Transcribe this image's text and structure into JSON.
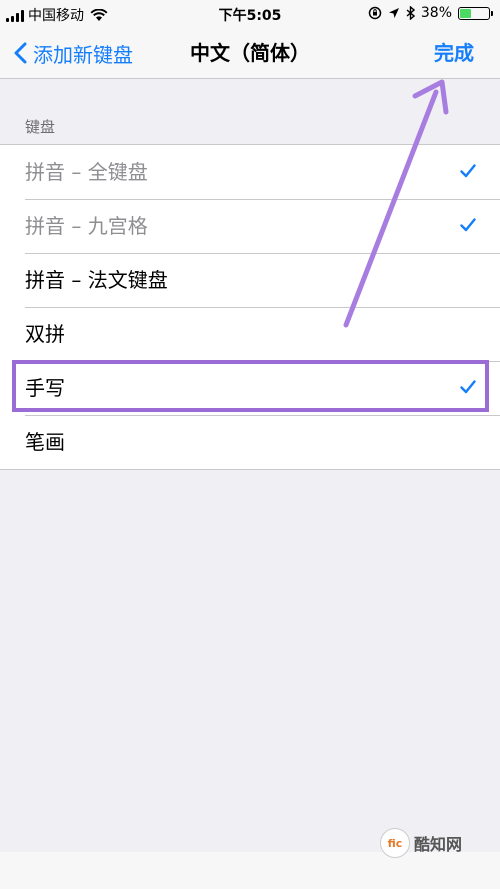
{
  "status_bar": {
    "carrier": "中国移动",
    "time": "下午5:05",
    "battery_pct": "38%",
    "battery_level": 0.38,
    "icons": [
      "signal-icon",
      "wifi-icon",
      "rotation-lock-icon",
      "location-icon",
      "bluetooth-icon",
      "battery-icon"
    ]
  },
  "nav": {
    "back_label": "添加新键盘",
    "title": "中文（简体）",
    "done_label": "完成"
  },
  "section": {
    "header": "键盘"
  },
  "rows": [
    {
      "label": "拼音 – 全键盘",
      "checked": true,
      "disabled": true
    },
    {
      "label": "拼音 – 九宫格",
      "checked": true,
      "disabled": true
    },
    {
      "label": "拼音 – 法文键盘",
      "checked": false,
      "disabled": false
    },
    {
      "label": "双拼",
      "checked": false,
      "disabled": false
    },
    {
      "label": "手写",
      "checked": true,
      "disabled": false
    },
    {
      "label": "笔画",
      "checked": false,
      "disabled": false
    }
  ],
  "watermark": {
    "logo_text": "fic",
    "text": "酷知网"
  },
  "colors": {
    "accent": "#147efb",
    "annotation": "#9b6bd6",
    "background": "#efeff4"
  }
}
